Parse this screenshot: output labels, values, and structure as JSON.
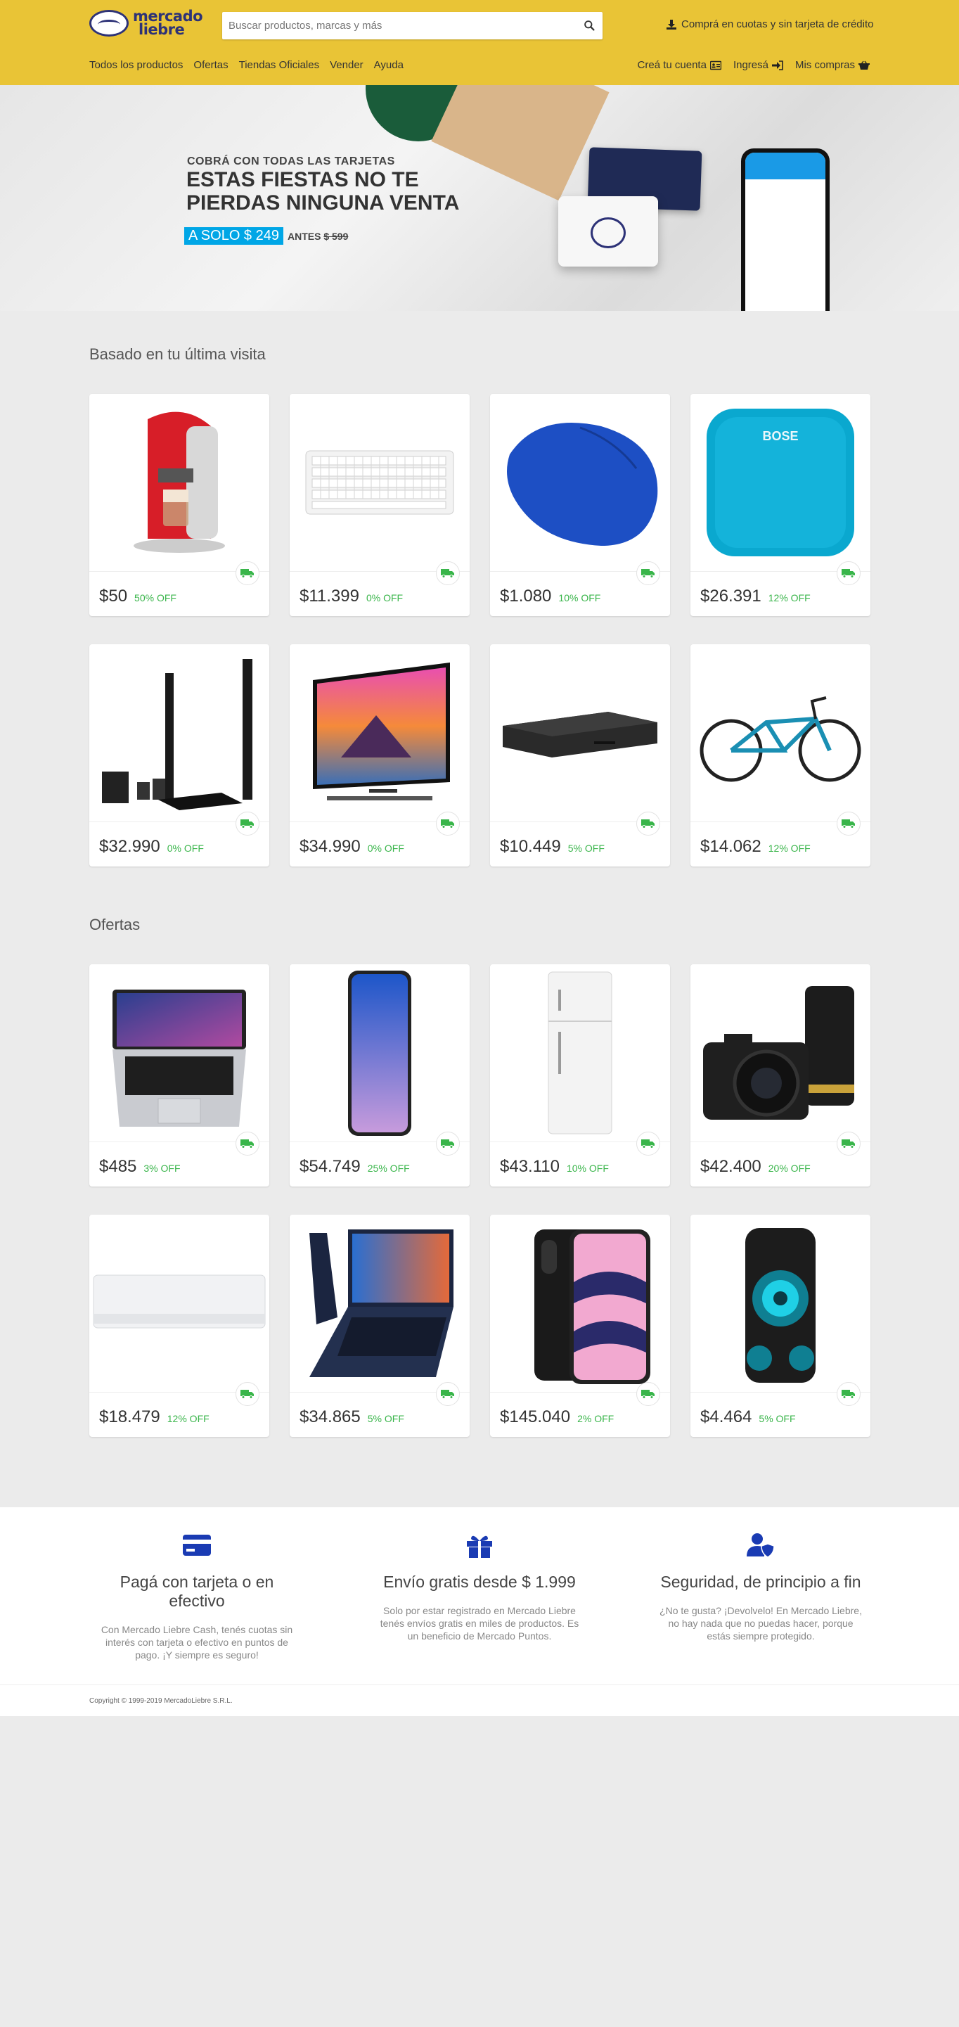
{
  "brand": {
    "line1": "mercado",
    "line2": "liebre"
  },
  "search": {
    "placeholder": "Buscar productos, marcas y más"
  },
  "promo": {
    "label": "Comprá en cuotas y sin tarjeta de crédito"
  },
  "nav": [
    "Todos los productos",
    "Ofertas",
    "Tiendas Oficiales",
    "Vender",
    "Ayuda"
  ],
  "account": {
    "register": "Creá tu cuenta",
    "login": "Ingresá",
    "purchases": "Mis compras"
  },
  "banner": {
    "kicker": "COBRÁ CON TODAS LAS TARJETAS",
    "title_line1": "ESTAS FIESTAS NO TE",
    "title_line2": "PIERDAS NINGUNA VENTA",
    "price": "A SOLO $ 249",
    "before_label": "ANTES",
    "before_price": "$ 599"
  },
  "sections": [
    {
      "title": "Basado en tu última visita",
      "products": [
        {
          "icon": "coffee-maker-icon",
          "price": "$50",
          "discount": "50% OFF"
        },
        {
          "icon": "keyboard-icon",
          "price": "$11.399",
          "discount": "0% OFF"
        },
        {
          "icon": "mouse-icon",
          "price": "$1.080",
          "discount": "10% OFF"
        },
        {
          "icon": "speaker-icon",
          "price": "$26.391",
          "discount": "12% OFF"
        },
        {
          "icon": "home-theater-icon",
          "price": "$32.990",
          "discount": "0% OFF"
        },
        {
          "icon": "tv-icon",
          "price": "$34.990",
          "discount": "0% OFF"
        },
        {
          "icon": "bluray-player-icon",
          "price": "$10.449",
          "discount": "5% OFF"
        },
        {
          "icon": "bicycle-icon",
          "price": "$14.062",
          "discount": "12% OFF"
        }
      ]
    },
    {
      "title": "Ofertas",
      "products": [
        {
          "icon": "laptop-icon",
          "price": "$485",
          "discount": "3% OFF"
        },
        {
          "icon": "smartphone-icon",
          "price": "$54.749",
          "discount": "25% OFF"
        },
        {
          "icon": "refrigerator-icon",
          "price": "$43.110",
          "discount": "10% OFF"
        },
        {
          "icon": "camera-icon",
          "price": "$42.400",
          "discount": "20% OFF"
        },
        {
          "icon": "air-conditioner-icon",
          "price": "$18.479",
          "discount": "12% OFF"
        },
        {
          "icon": "notebook-icon",
          "price": "$34.865",
          "discount": "5% OFF"
        },
        {
          "icon": "iphone-icon",
          "price": "$145.040",
          "discount": "2% OFF"
        },
        {
          "icon": "party-speaker-icon",
          "price": "$4.464",
          "discount": "5% OFF"
        }
      ]
    }
  ],
  "info": [
    {
      "icon": "credit-card-icon",
      "title": "Pagá con tarjeta o en efectivo",
      "text": "Con Mercado Liebre Cash, tenés cuotas sin interés con tarjeta o efectivo en puntos de pago. ¡Y siempre es seguro!"
    },
    {
      "icon": "gift-icon",
      "title": "Envío gratis desde $ 1.999",
      "text": "Solo por estar registrado en Mercado Liebre tenés envíos gratis en miles de productos. Es un beneficio de Mercado Puntos."
    },
    {
      "icon": "user-shield-icon",
      "title": "Seguridad, de principio a fin",
      "text": "¿No te gusta? ¡Devolvelo! En Mercado Liebre, no hay nada que no puedas hacer, porque estás siempre protegido."
    }
  ],
  "copyright": "Copyright © 1999-2019 MercadoLiebre S.R.L.",
  "colors": {
    "header": "#e9c436",
    "accent_blue": "#3483fa",
    "discount_green": "#39b54a",
    "icon_blue": "#1a3bb3"
  }
}
